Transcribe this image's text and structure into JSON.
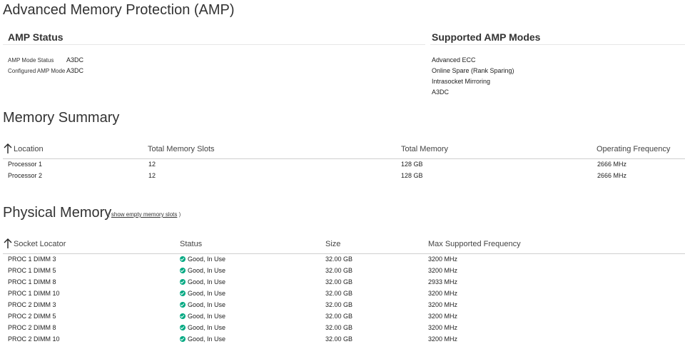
{
  "page_title": "Advanced Memory Protection (AMP)",
  "amp_status": {
    "title": "AMP Status",
    "mode_status_label": "AMP Mode Status",
    "mode_status_value": "A3DC",
    "configured_mode_label": "Configured AMP Mode",
    "configured_mode_value": "A3DC"
  },
  "supported_modes": {
    "title": "Supported AMP Modes",
    "items": [
      "Advanced ECC",
      "Online Spare (Rank Sparing)",
      "Intrasocket Mirroring",
      "A3DC"
    ]
  },
  "memory_summary": {
    "title": "Memory Summary",
    "columns": [
      "Location",
      "Total Memory Slots",
      "Total Memory",
      "Operating Frequency"
    ],
    "rows": [
      [
        "Processor 1",
        "12",
        "128 GB",
        "2666 MHz"
      ],
      [
        "Processor 2",
        "12",
        "128 GB",
        "2666 MHz"
      ]
    ]
  },
  "physical_memory": {
    "title": "Physical Memory",
    "link_open": "(",
    "show_empty_link": "show empty memory slots",
    "link_close": ")",
    "columns": [
      "Socket Locator",
      "Status",
      "Size",
      "Max Supported Frequency"
    ],
    "status_color": "#01a982",
    "rows": [
      [
        "PROC 1 DIMM 3",
        "Good, In Use",
        "32.00 GB",
        "3200 MHz"
      ],
      [
        "PROC 1 DIMM 5",
        "Good, In Use",
        "32.00 GB",
        "3200 MHz"
      ],
      [
        "PROC 1 DIMM 8",
        "Good, In Use",
        "32.00 GB",
        "2933 MHz"
      ],
      [
        "PROC 1 DIMM 10",
        "Good, In Use",
        "32.00 GB",
        "3200 MHz"
      ],
      [
        "PROC 2 DIMM 3",
        "Good, In Use",
        "32.00 GB",
        "3200 MHz"
      ],
      [
        "PROC 2 DIMM 5",
        "Good, In Use",
        "32.00 GB",
        "3200 MHz"
      ],
      [
        "PROC 2 DIMM 8",
        "Good, In Use",
        "32.00 GB",
        "3200 MHz"
      ],
      [
        "PROC 2 DIMM 10",
        "Good, In Use",
        "32.00 GB",
        "3200 MHz"
      ]
    ]
  },
  "icons": {
    "sort": "arrow-up-icon",
    "status": "check-circle-icon"
  }
}
